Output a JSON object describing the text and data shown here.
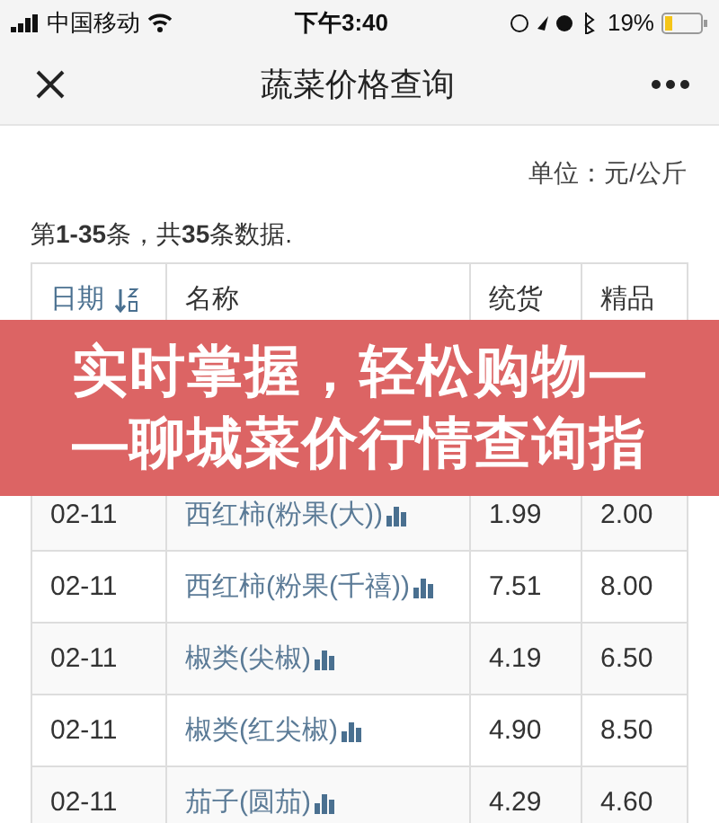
{
  "status_bar": {
    "carrier": "中国移动",
    "time": "下午3:40",
    "battery": "19%"
  },
  "nav": {
    "title": "蔬菜价格查询"
  },
  "unit": "单位：元/公斤",
  "summary": "第**1-35**条，共**35**条数据.",
  "table": {
    "columns": [
      {
        "label": "日期",
        "sortable": true
      },
      {
        "label": "名称",
        "sortable": false
      },
      {
        "label": "统货",
        "sortable": false
      },
      {
        "label": "精品",
        "sortable": false
      }
    ],
    "rows": [
      {
        "date": "02-11",
        "name": "西红柿(粉果(大))",
        "price_1": "1.99",
        "price_2": "2.00"
      },
      {
        "date": "02-11",
        "name": "西红柿(粉果(千禧))",
        "price_1": "7.51",
        "price_2": "8.00"
      },
      {
        "date": "02-11",
        "name": "椒类(尖椒)",
        "price_1": "4.19",
        "price_2": "6.50"
      },
      {
        "date": "02-11",
        "name": "椒类(红尖椒)",
        "price_1": "4.90",
        "price_2": "8.50"
      },
      {
        "date": "02-11",
        "name": "茄子(圆茄)",
        "price_1": "4.29",
        "price_2": "4.60"
      }
    ]
  },
  "banner": {
    "lines": [
      "实时掌握，轻松购物—",
      "—聊城菜价行情查询指"
    ]
  }
}
